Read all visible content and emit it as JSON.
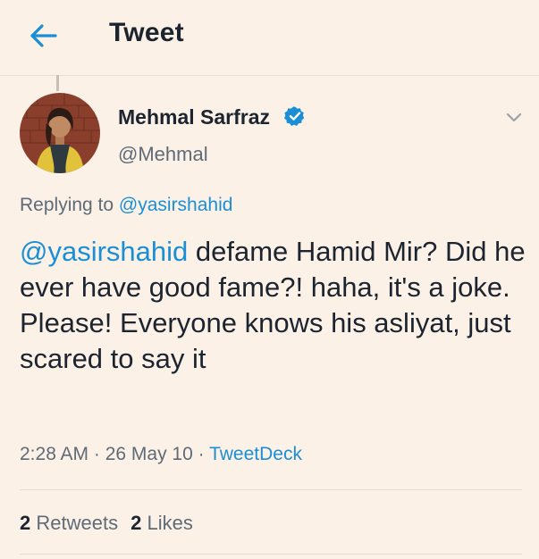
{
  "header": {
    "title": "Tweet"
  },
  "tweet": {
    "author_name": "Mehmal Sarfraz",
    "handle": "@Mehmal",
    "replying_prefix": "Replying to ",
    "replying_to": "@yasirshahid",
    "body_mention": "@yasirshahid",
    "body_text": " defame Hamid Mir? Did he ever have good fame?! haha, it's a joke. Please! Everyone knows his asliyat, just scared to say it",
    "time": "2:28 AM",
    "date": "26 May 10",
    "separator": " · ",
    "source": "TweetDeck"
  },
  "stats": {
    "retweets_count": "2",
    "retweets_label": "Retweets",
    "likes_count": "2",
    "likes_label": "Likes"
  },
  "icons": {
    "back": "arrow-left-icon",
    "verified": "verified-badge-icon",
    "more": "chevron-down-icon"
  },
  "colors": {
    "background": "#fbf1e6",
    "accent": "#1b8fd6",
    "text": "#1c2430",
    "muted": "#5f6b78"
  }
}
